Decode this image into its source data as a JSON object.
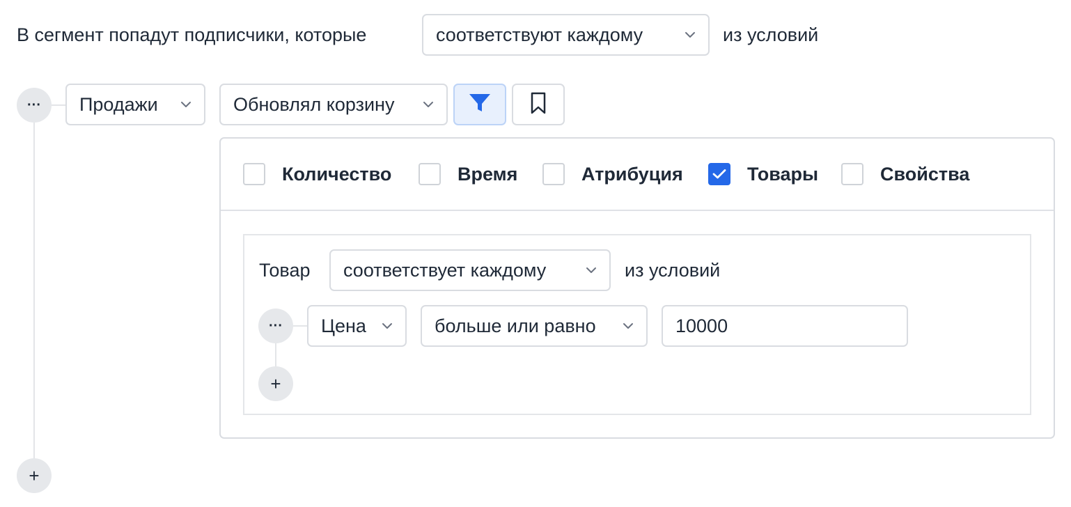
{
  "header": {
    "prefix": "В сегмент попадут подписчики, которые",
    "match_select": "соответствуют каждому",
    "suffix": "из условий"
  },
  "rule": {
    "category_select": "Продажи",
    "event_select": "Обновлял корзину",
    "filter_button_icon": "filter-icon",
    "bookmark_button_icon": "bookmark-icon"
  },
  "filters": {
    "options": [
      {
        "label": "Количество",
        "checked": false
      },
      {
        "label": "Время",
        "checked": false
      },
      {
        "label": "Атрибуция",
        "checked": false
      },
      {
        "label": "Товары",
        "checked": true
      },
      {
        "label": "Свойства",
        "checked": false
      }
    ]
  },
  "product": {
    "prefix": "Товар",
    "match_select": "соответствует каждому",
    "suffix": "из условий",
    "condition": {
      "field_select": "Цена",
      "operator_select": "больше или равно",
      "value": "10000"
    }
  },
  "controls": {
    "more_glyph": "···",
    "add_glyph": "+"
  },
  "colors": {
    "accent": "#2468e8",
    "border": "#d9dce1",
    "text": "#1f2937"
  }
}
